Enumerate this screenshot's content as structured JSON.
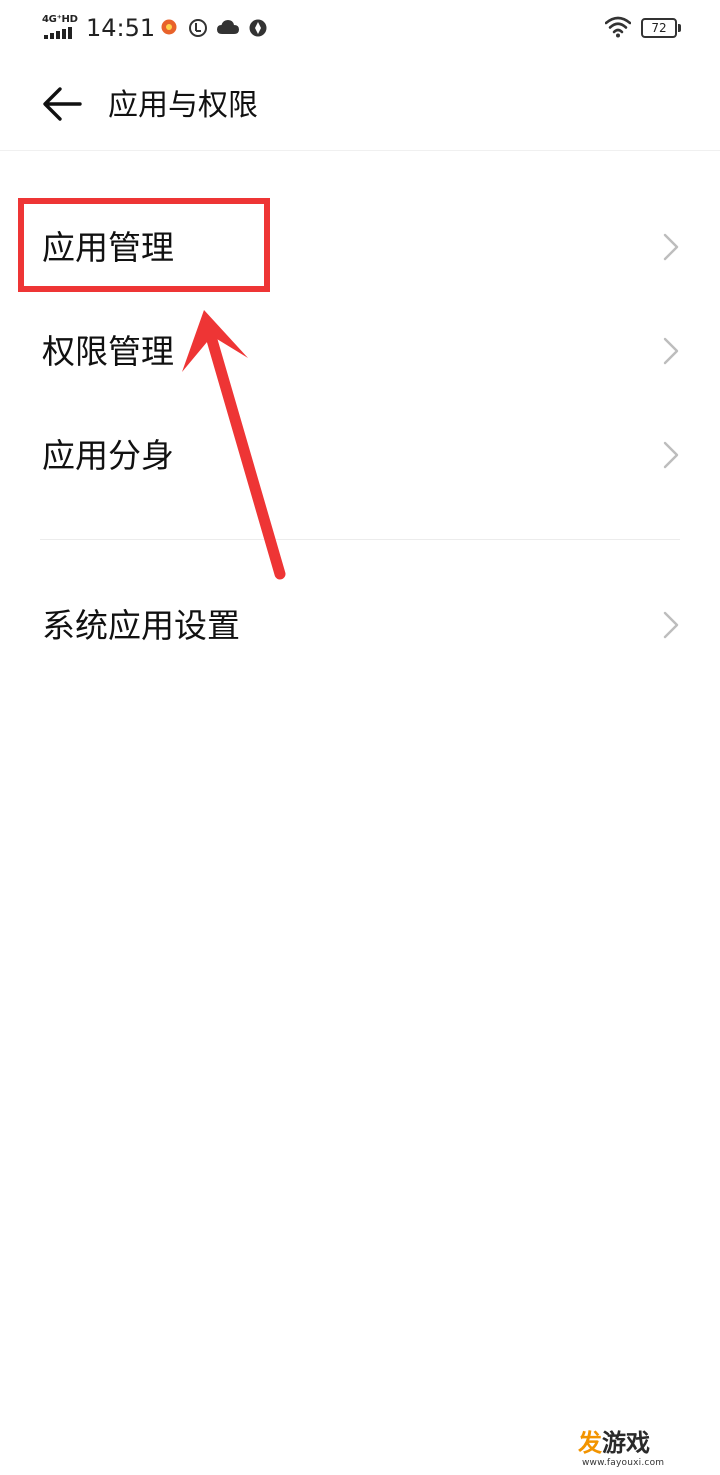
{
  "status_bar": {
    "network_type": "4G⁺HD",
    "time": "14:51",
    "battery_level": "72",
    "icons": [
      "signal-icon",
      "app-notification-icon",
      "data-saver-icon",
      "cloud-icon",
      "browser-icon",
      "wifi-icon",
      "battery-icon"
    ]
  },
  "header": {
    "title": "应用与权限",
    "back_icon": "back-arrow-icon"
  },
  "list": {
    "group1": [
      {
        "label": "应用管理",
        "icon": "chevron-right-icon"
      },
      {
        "label": "权限管理",
        "icon": "chevron-right-icon"
      },
      {
        "label": "应用分身",
        "icon": "chevron-right-icon"
      }
    ],
    "group2": [
      {
        "label": "系统应用设置",
        "icon": "chevron-right-icon"
      }
    ]
  },
  "annotation": {
    "highlight_color": "#ee3535",
    "highlighted_item": "应用管理"
  },
  "watermark": {
    "brand_part1": "发",
    "brand_part2": "游戏",
    "url": "www.fayouxi.com"
  }
}
